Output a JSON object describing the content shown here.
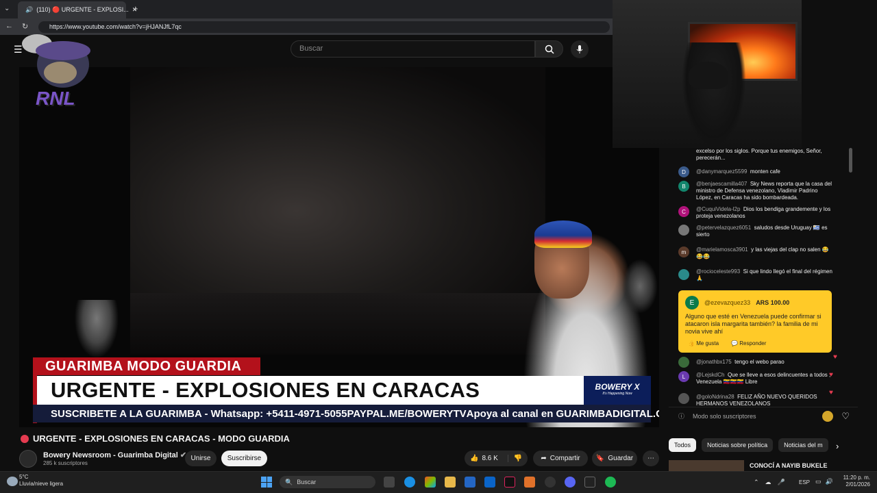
{
  "browser": {
    "tab_title": "(110) 🔴 URGENTE - EXPLOSI...",
    "url": "https://www.youtube.com/watch?v=jHJANJfL7qc"
  },
  "youtube": {
    "search_placeholder": "Buscar",
    "video": {
      "banner_top": "GUARIMBA MODO GUARDIA",
      "banner_main": "URGENTE - EXPLOSIONES EN CARACAS",
      "banner_logo": "BOWERY X",
      "banner_logo_sub": "It's Happening Now",
      "ticker": [
        "SUSCRIBETE A LA GUARIMBA - Whatsapp: +5411-4971-5055",
        "PAYPAL.ME/BOWERYTV",
        "Apoya al canal en GUARIMBADIGITAL.COM",
        ":)"
      ],
      "overlay_logo": "RNL"
    },
    "title": "URGENTE - EXPLOSIONES EN CARACAS - MODO GUARDIA",
    "channel": {
      "name": "Bowery Newsroom - Guarimba Digital",
      "subscribers": "285 k suscriptores",
      "join_label": "Unirse",
      "subscribe_label": "Suscribirse"
    },
    "actions": {
      "likes": "8.6 K",
      "share": "Compartir",
      "save": "Guardar"
    },
    "chat": {
      "messages": [
        {
          "user": "",
          "text": "excelso por los siglos. Porque tus enemigos, Señor, perecerán...",
          "initial": ""
        },
        {
          "user": "@danymarquez5599",
          "text": "monten cafe",
          "initial": "D",
          "color": "#3a5a8a"
        },
        {
          "user": "@benjaescamilla407",
          "text": "Sky News reporta que la casa del ministro de Defensa venezolano, Vladimir Padrino López, en Caracas ha sido bombardeada.",
          "initial": "B",
          "color": "#12856c"
        },
        {
          "user": "@CuquiVidela-l2p",
          "text": "Dios los bendiga grandemente y los proteja venezolanos",
          "initial": "C",
          "color": "#b0127a"
        },
        {
          "user": "@petervelazquez6051",
          "text": "saludos desde Uruguay 🇺🇾 es sierto",
          "initial": "",
          "color": "#777"
        },
        {
          "user": "@marielamosca3901",
          "text": "y las viejas del clap no salen 😂😂😂",
          "initial": "m",
          "color": "#5a3a2a"
        },
        {
          "user": "@rocioceleste993",
          "text": "Si que lindo llegó el final del régimen 🙏",
          "initial": "",
          "color": "#2a8a8a"
        },
        {
          "user": "@jonathbx175",
          "text": "tengo el webo parao",
          "initial": "",
          "color": "#3a6a3a"
        },
        {
          "user": "@LejskdCh",
          "text": "Que se lleve a esos delincuentes a todos , Venezuela 🇻🇪🇻🇪🇻🇪 Libre",
          "initial": "L",
          "color": "#6a3ab0"
        },
        {
          "user": "@goloNdrina28",
          "text": "FELIZ AÑO NUEVO QUERIDOS HERMANOS VENEZOLANOS",
          "initial": "",
          "color": "#555"
        }
      ],
      "superchat": {
        "user": "@ezevazquez33",
        "initial": "E",
        "amount": "ARS 100.00",
        "text": "Alguno que esté en Venezuela puede confirmar si atacaron isla margarita también? la familia de mi novia vive ahí",
        "like_label": "Me gusta",
        "reply_label": "Responder"
      },
      "footer": "Modo solo suscriptores"
    },
    "chips": [
      "Todos",
      "Noticias sobre política",
      "Noticias del m"
    ],
    "recommended_title": "CONOCÍ A NAYIB BUKELE"
  },
  "taskbar": {
    "temperature": "5°C",
    "weather": "Lluvia/nieve ligera",
    "search": "Buscar",
    "language": "ESP",
    "time": "11:20 p. m.",
    "date": "2/01/2026"
  }
}
